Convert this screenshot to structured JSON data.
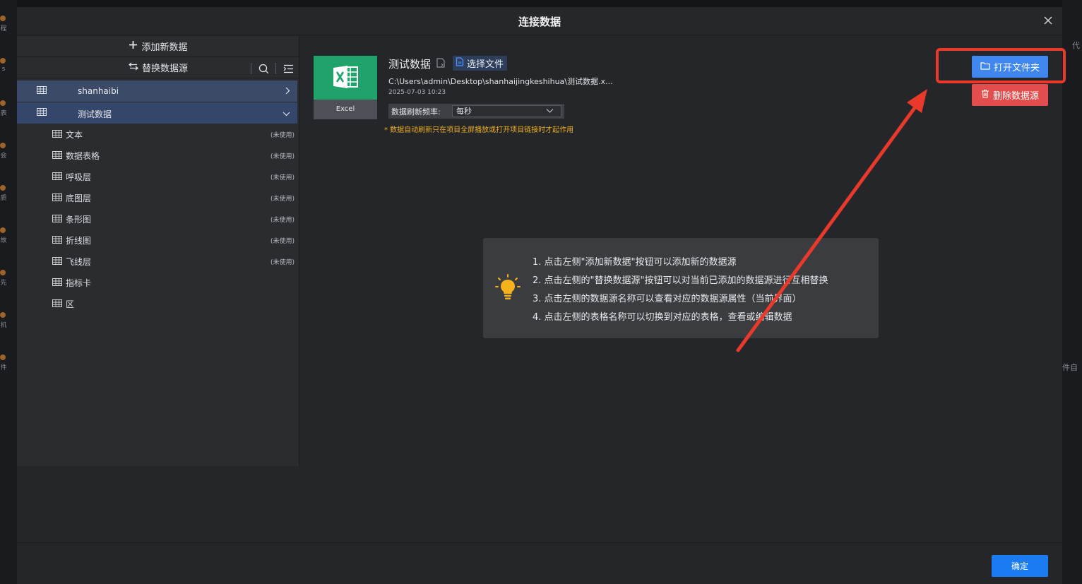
{
  "background": {
    "left_labels": [
      "程",
      "s",
      "表",
      "会",
      "质",
      "故",
      "先",
      "机",
      "件"
    ],
    "right_labels": [
      "代",
      "件自"
    ]
  },
  "modal": {
    "title": "连接数据"
  },
  "sidebar": {
    "add_label": "添加新数据",
    "replace_label": "替换数据源",
    "sources": [
      {
        "name": "shanhaibi",
        "expanded": false
      },
      {
        "name": "测试数据",
        "expanded": true
      }
    ],
    "tables": [
      {
        "name": "文本",
        "status": "(未使用)"
      },
      {
        "name": "数据表格",
        "status": "(未使用)"
      },
      {
        "name": "呼吸层",
        "status": "(未使用)"
      },
      {
        "name": "底图层",
        "status": "(未使用)"
      },
      {
        "name": "条形图",
        "status": "(未使用)"
      },
      {
        "name": "折线图",
        "status": "(未使用)"
      },
      {
        "name": "飞线层",
        "status": "(未使用)"
      },
      {
        "name": "指标卡",
        "status": ""
      },
      {
        "name": "区",
        "status": ""
      }
    ]
  },
  "detail": {
    "tile_caption": "Excel",
    "source_name": "测试数据",
    "choose_file_label": "选择文件",
    "path": "C:\\Users\\admin\\Desktop\\shanhaijingkeshihua\\测试数据.x...",
    "date": "2025-07-03 10:23",
    "refresh_label": "数据刷新频率:",
    "refresh_value": "每秒",
    "note": "* 数据自动刷新只在项目全屏播放或打开项目链接时才起作用",
    "open_folder_label": "打开文件夹",
    "delete_label": "删除数据源"
  },
  "tips": [
    "1. 点击左侧\"添加新数据\"按钮可以添加新的数据源",
    "2. 点击左侧的\"替换数据源\"按钮可以对当前已添加的数据源进行互相替换",
    "3. 点击左侧的数据源名称可以查看对应的数据源属性（当前界面）",
    "4. 点击左侧的表格名称可以切换到对应的表格，查看或编辑数据"
  ],
  "footer": {
    "ok_label": "确定"
  },
  "colors": {
    "accent": "#3f86ef",
    "danger": "#e44d4d",
    "excel_green": "#1fa36a",
    "highlight_red": "#e8392a",
    "warning": "#f0b020"
  }
}
